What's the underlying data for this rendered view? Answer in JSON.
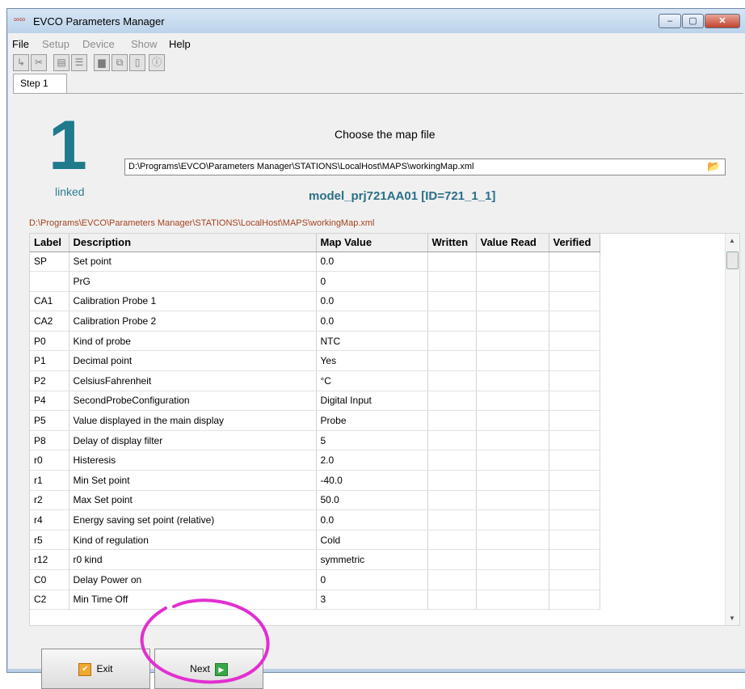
{
  "window": {
    "title": "EVCO Parameters Manager",
    "app_icon": "evco-logo-icon",
    "controls": {
      "minimize": "–",
      "maximize": "▢",
      "close": "✕"
    }
  },
  "menu": {
    "items": [
      {
        "label": "File",
        "enabled": true
      },
      {
        "label": "Setup",
        "enabled": false
      },
      {
        "label": "Device",
        "enabled": false
      },
      {
        "label": "Show",
        "enabled": false
      },
      {
        "label": "Help",
        "enabled": true
      }
    ]
  },
  "toolbar": {
    "icons": [
      "connect-icon",
      "tools-icon",
      "doc-icon",
      "list-icon",
      "print-icon",
      "copy-icon",
      "page-icon",
      "info-icon"
    ]
  },
  "tabs": [
    {
      "label": "Step 1",
      "active": true
    }
  ],
  "step": {
    "number": "1",
    "status": "linked",
    "choose_label": "Choose the map file",
    "file_path": "D:\\Programs\\EVCO\\Parameters Manager\\STATIONS\\LocalHost\\MAPS\\workingMap.xml",
    "model_label": "model_prj721AA01 [ID=721_1_1]",
    "map_path_label": "D:\\Programs\\EVCO\\Parameters Manager\\STATIONS\\LocalHost\\MAPS\\workingMap.xml"
  },
  "table": {
    "headers": {
      "label": "Label",
      "description": "Description",
      "map_value": "Map Value",
      "written": "Written",
      "value_read": "Value Read",
      "verified": "Verified"
    },
    "rows": [
      {
        "label": "SP",
        "description": "Set point",
        "map_value": "0.0"
      },
      {
        "label": "",
        "description": "PrG",
        "map_value": "0"
      },
      {
        "label": "CA1",
        "description": "Calibration Probe 1",
        "map_value": "0.0"
      },
      {
        "label": "CA2",
        "description": "Calibration Probe 2",
        "map_value": "0.0"
      },
      {
        "label": "P0",
        "description": "Kind of probe",
        "map_value": "NTC"
      },
      {
        "label": "P1",
        "description": "Decimal point",
        "map_value": "Yes"
      },
      {
        "label": "P2",
        "description": "CelsiusFahrenheit",
        "map_value": "°C"
      },
      {
        "label": "P4",
        "description": "SecondProbeConfiguration",
        "map_value": "Digital Input"
      },
      {
        "label": "P5",
        "description": "Value displayed in the main display",
        "map_value": "Probe"
      },
      {
        "label": "P8",
        "description": "Delay of display filter",
        "map_value": "5"
      },
      {
        "label": "r0",
        "description": "Histeresis",
        "map_value": "2.0"
      },
      {
        "label": "r1",
        "description": "Min Set point",
        "map_value": "-40.0"
      },
      {
        "label": "r2",
        "description": "Max Set point",
        "map_value": "50.0"
      },
      {
        "label": "r4",
        "description": "Energy saving set point (relative)",
        "map_value": "0.0"
      },
      {
        "label": "r5",
        "description": "Kind of regulation",
        "map_value": "Cold"
      },
      {
        "label": "r12",
        "description": "r0 kind",
        "map_value": "symmetric"
      },
      {
        "label": "C0",
        "description": "Delay Power on",
        "map_value": "0"
      },
      {
        "label": "C2",
        "description": "Min Time Off",
        "map_value": "3"
      }
    ]
  },
  "buttons": {
    "exit": "Exit",
    "next": "Next"
  },
  "colors": {
    "accent": "#1f7a8c",
    "path_text": "#a3421f",
    "annotation": "#e22fd0"
  }
}
